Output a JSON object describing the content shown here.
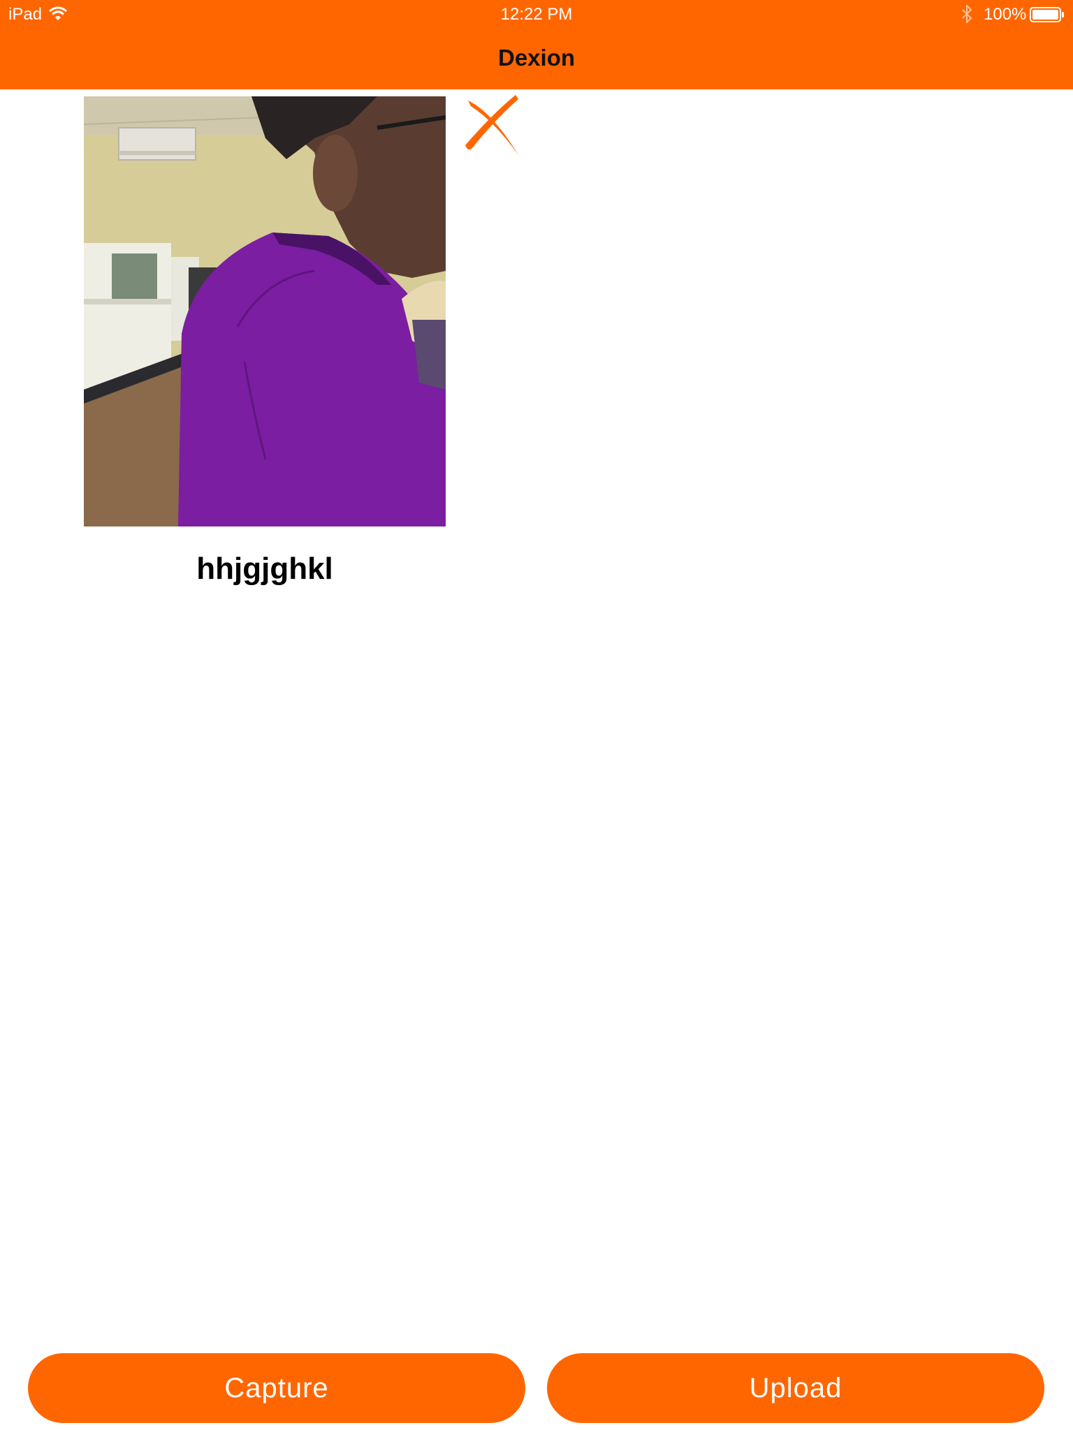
{
  "status_bar": {
    "device": "iPad",
    "time": "12:22 PM",
    "battery": "100%",
    "icons": [
      "wifi-icon",
      "bluetooth-icon",
      "battery-icon"
    ]
  },
  "nav": {
    "title": "Dexion"
  },
  "photo_item": {
    "caption": "hhjgjghkl",
    "delete_icon": "close-icon"
  },
  "buttons": {
    "capture": "Capture",
    "upload": "Upload"
  },
  "colors": {
    "accent": "#ff6600",
    "background": "#ffffff"
  }
}
